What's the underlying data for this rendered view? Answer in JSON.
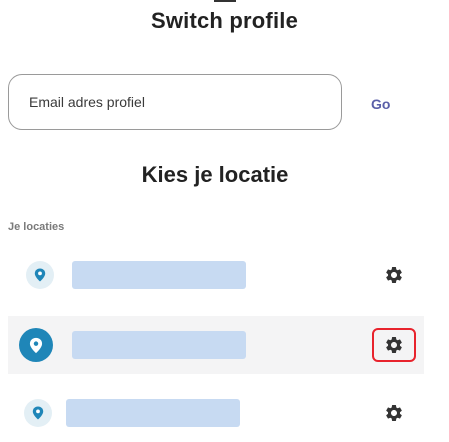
{
  "header": {
    "title": "Switch profile"
  },
  "profile_form": {
    "email_placeholder": "Email adres profiel",
    "email_value": "",
    "go_label": "Go"
  },
  "location_section": {
    "title": "Kies je locatie",
    "list_label": "Je locaties",
    "locations": [
      {
        "name": "",
        "selected": false,
        "pin_icon": "location-pin-icon",
        "settings_icon": "gear-icon"
      },
      {
        "name": "",
        "selected": true,
        "pin_icon": "location-pin-icon",
        "settings_icon": "gear-icon"
      },
      {
        "name": "",
        "selected": false,
        "pin_icon": "location-pin-icon",
        "settings_icon": "gear-icon"
      }
    ]
  },
  "colors": {
    "accent_link": "#5a5fa8",
    "pin_selected": "#1f86b8",
    "pin_default_bg": "#e3eff5",
    "highlight_border": "#e8232d",
    "redacted_bar": "#c7daf2"
  }
}
